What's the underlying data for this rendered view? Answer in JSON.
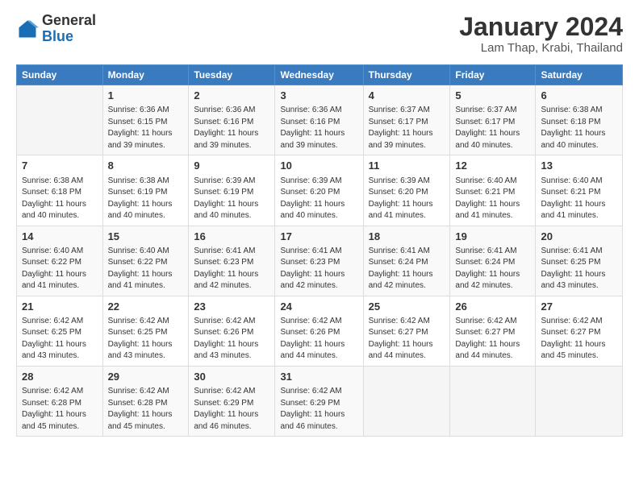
{
  "header": {
    "logo_general": "General",
    "logo_blue": "Blue",
    "month_title": "January 2024",
    "location": "Lam Thap, Krabi, Thailand"
  },
  "weekdays": [
    "Sunday",
    "Monday",
    "Tuesday",
    "Wednesday",
    "Thursday",
    "Friday",
    "Saturday"
  ],
  "weeks": [
    [
      {
        "day": "",
        "sunrise": "",
        "sunset": "",
        "daylight": ""
      },
      {
        "day": "1",
        "sunrise": "Sunrise: 6:36 AM",
        "sunset": "Sunset: 6:15 PM",
        "daylight": "Daylight: 11 hours and 39 minutes."
      },
      {
        "day": "2",
        "sunrise": "Sunrise: 6:36 AM",
        "sunset": "Sunset: 6:16 PM",
        "daylight": "Daylight: 11 hours and 39 minutes."
      },
      {
        "day": "3",
        "sunrise": "Sunrise: 6:36 AM",
        "sunset": "Sunset: 6:16 PM",
        "daylight": "Daylight: 11 hours and 39 minutes."
      },
      {
        "day": "4",
        "sunrise": "Sunrise: 6:37 AM",
        "sunset": "Sunset: 6:17 PM",
        "daylight": "Daylight: 11 hours and 39 minutes."
      },
      {
        "day": "5",
        "sunrise": "Sunrise: 6:37 AM",
        "sunset": "Sunset: 6:17 PM",
        "daylight": "Daylight: 11 hours and 40 minutes."
      },
      {
        "day": "6",
        "sunrise": "Sunrise: 6:38 AM",
        "sunset": "Sunset: 6:18 PM",
        "daylight": "Daylight: 11 hours and 40 minutes."
      }
    ],
    [
      {
        "day": "7",
        "sunrise": "Sunrise: 6:38 AM",
        "sunset": "Sunset: 6:18 PM",
        "daylight": "Daylight: 11 hours and 40 minutes."
      },
      {
        "day": "8",
        "sunrise": "Sunrise: 6:38 AM",
        "sunset": "Sunset: 6:19 PM",
        "daylight": "Daylight: 11 hours and 40 minutes."
      },
      {
        "day": "9",
        "sunrise": "Sunrise: 6:39 AM",
        "sunset": "Sunset: 6:19 PM",
        "daylight": "Daylight: 11 hours and 40 minutes."
      },
      {
        "day": "10",
        "sunrise": "Sunrise: 6:39 AM",
        "sunset": "Sunset: 6:20 PM",
        "daylight": "Daylight: 11 hours and 40 minutes."
      },
      {
        "day": "11",
        "sunrise": "Sunrise: 6:39 AM",
        "sunset": "Sunset: 6:20 PM",
        "daylight": "Daylight: 11 hours and 41 minutes."
      },
      {
        "day": "12",
        "sunrise": "Sunrise: 6:40 AM",
        "sunset": "Sunset: 6:21 PM",
        "daylight": "Daylight: 11 hours and 41 minutes."
      },
      {
        "day": "13",
        "sunrise": "Sunrise: 6:40 AM",
        "sunset": "Sunset: 6:21 PM",
        "daylight": "Daylight: 11 hours and 41 minutes."
      }
    ],
    [
      {
        "day": "14",
        "sunrise": "Sunrise: 6:40 AM",
        "sunset": "Sunset: 6:22 PM",
        "daylight": "Daylight: 11 hours and 41 minutes."
      },
      {
        "day": "15",
        "sunrise": "Sunrise: 6:40 AM",
        "sunset": "Sunset: 6:22 PM",
        "daylight": "Daylight: 11 hours and 41 minutes."
      },
      {
        "day": "16",
        "sunrise": "Sunrise: 6:41 AM",
        "sunset": "Sunset: 6:23 PM",
        "daylight": "Daylight: 11 hours and 42 minutes."
      },
      {
        "day": "17",
        "sunrise": "Sunrise: 6:41 AM",
        "sunset": "Sunset: 6:23 PM",
        "daylight": "Daylight: 11 hours and 42 minutes."
      },
      {
        "day": "18",
        "sunrise": "Sunrise: 6:41 AM",
        "sunset": "Sunset: 6:24 PM",
        "daylight": "Daylight: 11 hours and 42 minutes."
      },
      {
        "day": "19",
        "sunrise": "Sunrise: 6:41 AM",
        "sunset": "Sunset: 6:24 PM",
        "daylight": "Daylight: 11 hours and 42 minutes."
      },
      {
        "day": "20",
        "sunrise": "Sunrise: 6:41 AM",
        "sunset": "Sunset: 6:25 PM",
        "daylight": "Daylight: 11 hours and 43 minutes."
      }
    ],
    [
      {
        "day": "21",
        "sunrise": "Sunrise: 6:42 AM",
        "sunset": "Sunset: 6:25 PM",
        "daylight": "Daylight: 11 hours and 43 minutes."
      },
      {
        "day": "22",
        "sunrise": "Sunrise: 6:42 AM",
        "sunset": "Sunset: 6:25 PM",
        "daylight": "Daylight: 11 hours and 43 minutes."
      },
      {
        "day": "23",
        "sunrise": "Sunrise: 6:42 AM",
        "sunset": "Sunset: 6:26 PM",
        "daylight": "Daylight: 11 hours and 43 minutes."
      },
      {
        "day": "24",
        "sunrise": "Sunrise: 6:42 AM",
        "sunset": "Sunset: 6:26 PM",
        "daylight": "Daylight: 11 hours and 44 minutes."
      },
      {
        "day": "25",
        "sunrise": "Sunrise: 6:42 AM",
        "sunset": "Sunset: 6:27 PM",
        "daylight": "Daylight: 11 hours and 44 minutes."
      },
      {
        "day": "26",
        "sunrise": "Sunrise: 6:42 AM",
        "sunset": "Sunset: 6:27 PM",
        "daylight": "Daylight: 11 hours and 44 minutes."
      },
      {
        "day": "27",
        "sunrise": "Sunrise: 6:42 AM",
        "sunset": "Sunset: 6:27 PM",
        "daylight": "Daylight: 11 hours and 45 minutes."
      }
    ],
    [
      {
        "day": "28",
        "sunrise": "Sunrise: 6:42 AM",
        "sunset": "Sunset: 6:28 PM",
        "daylight": "Daylight: 11 hours and 45 minutes."
      },
      {
        "day": "29",
        "sunrise": "Sunrise: 6:42 AM",
        "sunset": "Sunset: 6:28 PM",
        "daylight": "Daylight: 11 hours and 45 minutes."
      },
      {
        "day": "30",
        "sunrise": "Sunrise: 6:42 AM",
        "sunset": "Sunset: 6:29 PM",
        "daylight": "Daylight: 11 hours and 46 minutes."
      },
      {
        "day": "31",
        "sunrise": "Sunrise: 6:42 AM",
        "sunset": "Sunset: 6:29 PM",
        "daylight": "Daylight: 11 hours and 46 minutes."
      },
      {
        "day": "",
        "sunrise": "",
        "sunset": "",
        "daylight": ""
      },
      {
        "day": "",
        "sunrise": "",
        "sunset": "",
        "daylight": ""
      },
      {
        "day": "",
        "sunrise": "",
        "sunset": "",
        "daylight": ""
      }
    ]
  ]
}
